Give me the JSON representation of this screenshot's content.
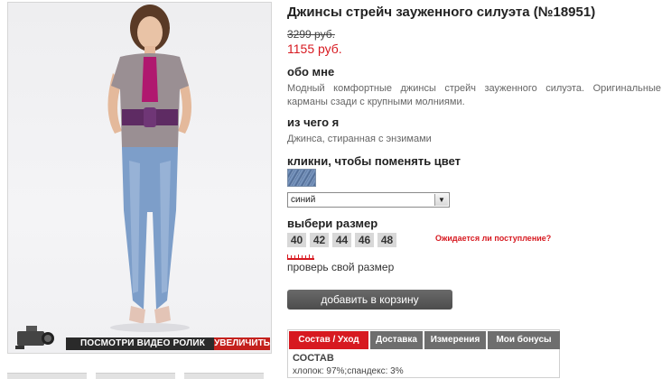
{
  "product": {
    "title": "Джинсы стрейч зауженного силуэта (№18951)",
    "old_price": "3299 руб.",
    "new_price": "1155 руб."
  },
  "about": {
    "heading": "обо мне",
    "text": "Модный комфортные джинсы стрейч зауженного силуэта. Оригинальные карманы сзади с крупными молниями."
  },
  "material": {
    "heading": "из чего я",
    "text": "Джинса, стиранная с энзимами"
  },
  "color": {
    "heading": "кликни, чтобы поменять цвет",
    "selected": "синий"
  },
  "size": {
    "heading": "выбери размер",
    "options": [
      "40",
      "42",
      "44",
      "46",
      "48"
    ],
    "notify_label": "Ожидается ли поступление?",
    "check_label": "проверь свой размер"
  },
  "cart": {
    "button_label": "добавить в корзину"
  },
  "tabs": {
    "items": [
      "Состав / Уход",
      "Доставка",
      "Измерения",
      "Мои бонусы"
    ],
    "active": "Состав / Уход",
    "composition_heading": "СОСТАВ",
    "composition_text": "хлопок: 97%;спандекс: 3%"
  },
  "photo": {
    "video_label": "ПОСМОТРИ ВИДЕО РОЛИК",
    "zoom_label": "УВЕЛИЧИТЬ"
  },
  "colors": {
    "accent_red": "#d71920",
    "button_gray": "#4c4c4c",
    "tab_gray": "#6e6e6e"
  }
}
